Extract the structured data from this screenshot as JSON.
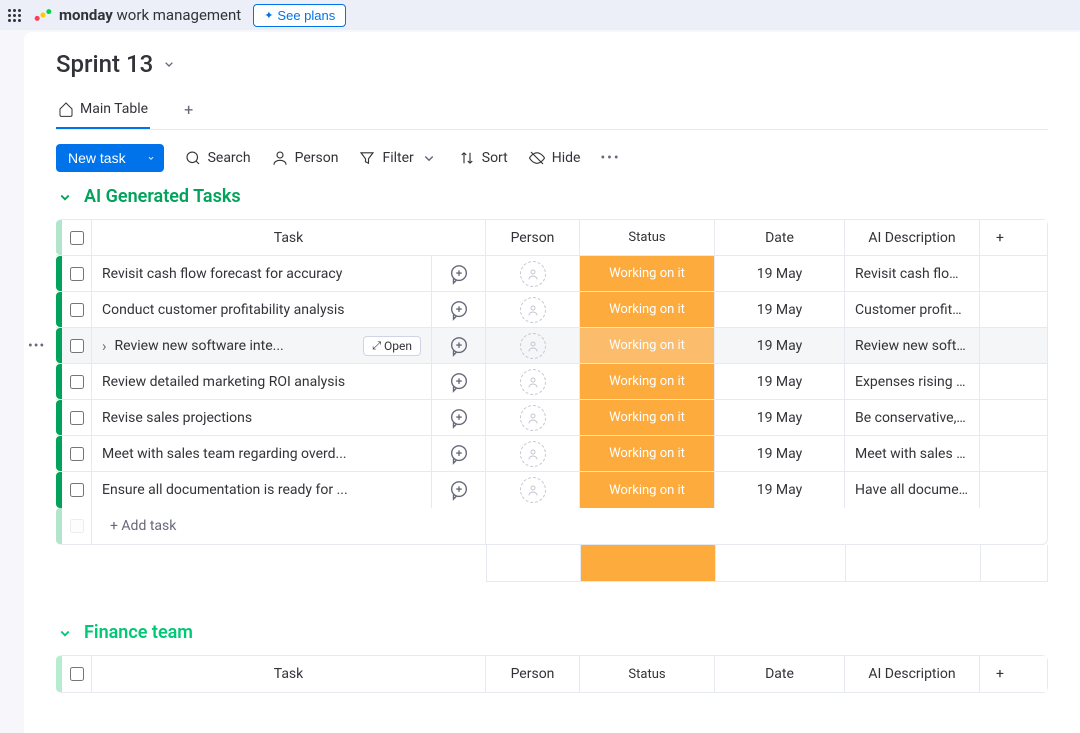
{
  "topbar": {
    "brand_bold": "monday",
    "brand_light": "work management",
    "see_plans": "See plans"
  },
  "board": {
    "title": "Sprint 13"
  },
  "tabs": {
    "main": "Main Table"
  },
  "toolbar": {
    "new_task": "New task",
    "search": "Search",
    "person": "Person",
    "filter": "Filter",
    "sort": "Sort",
    "hide": "Hide"
  },
  "groups": {
    "ai": {
      "name": "AI Generated Tasks",
      "color": "#00a359"
    },
    "fin": {
      "name": "Finance team",
      "color": "#00c875"
    }
  },
  "columns": {
    "task": "Task",
    "person": "Person",
    "status": "Status",
    "date": "Date",
    "aidesc": "AI Description"
  },
  "status_labels": {
    "working": "Working on it"
  },
  "colors": {
    "working": "#fdab3d"
  },
  "rows": [
    {
      "task": "Revisit cash flow forecast for accuracy",
      "status": "working",
      "date": "19 May",
      "aidesc": "Revisit cash flow fo..."
    },
    {
      "task": "Conduct customer profitability analysis",
      "status": "working",
      "date": "19 May",
      "aidesc": "Customer profitabil..."
    },
    {
      "task": "Review new software inte...",
      "status": "working",
      "date": "19 May",
      "aidesc": "Review new softwa...",
      "hovered": true,
      "open": true,
      "chevron": true
    },
    {
      "task": "Review detailed marketing ROI analysis",
      "status": "working",
      "date": "19 May",
      "aidesc": "Expenses rising - n..."
    },
    {
      "task": "Revise sales projections",
      "status": "working",
      "date": "19 May",
      "aidesc": "Be conservative, re..."
    },
    {
      "task": "Meet with sales team regarding overd...",
      "status": "working",
      "date": "19 May",
      "aidesc": "Meet with sales tea..."
    },
    {
      "task": "Ensure all documentation is ready for ...",
      "status": "working",
      "date": "19 May",
      "aidesc": "Have all document..."
    }
  ],
  "add_task": "+ Add task",
  "open_label": "Open"
}
